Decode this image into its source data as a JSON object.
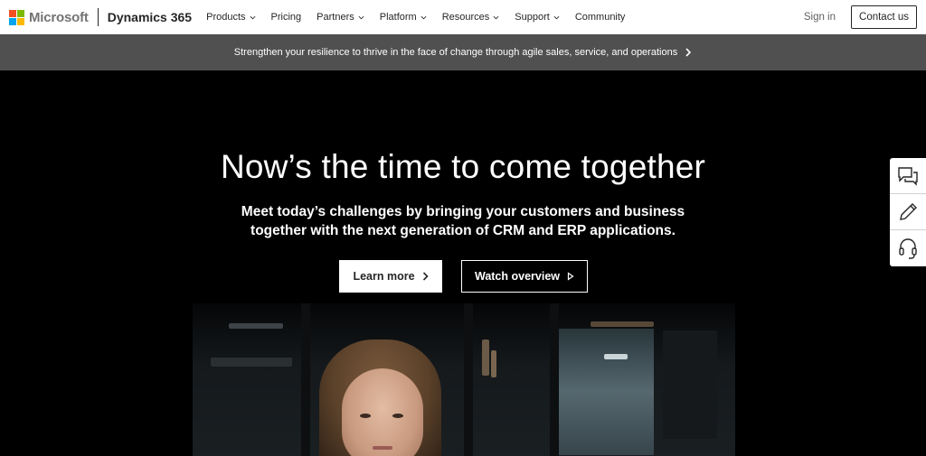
{
  "brand": {
    "company": "Microsoft",
    "product": "Dynamics 365",
    "logo_colors": [
      "#f25022",
      "#7fba00",
      "#00a4ef",
      "#ffb900"
    ]
  },
  "nav": {
    "items": [
      {
        "label": "Products",
        "has_dropdown": true
      },
      {
        "label": "Pricing",
        "has_dropdown": false
      },
      {
        "label": "Partners",
        "has_dropdown": true
      },
      {
        "label": "Platform",
        "has_dropdown": true
      },
      {
        "label": "Resources",
        "has_dropdown": true
      },
      {
        "label": "Support",
        "has_dropdown": true
      },
      {
        "label": "Community",
        "has_dropdown": false
      }
    ],
    "sign_in": "Sign in",
    "contact": "Contact us"
  },
  "banner": {
    "text": "Strengthen your resilience to thrive in the face of change through agile sales, service, and operations",
    "icon": "chevron-right-icon"
  },
  "hero": {
    "title": "Now’s the time to come together",
    "subtitle": "Meet today’s challenges by bringing your customers and business together with the next generation of CRM and ERP applications.",
    "primary_button": "Learn more",
    "secondary_button": "Watch overview"
  },
  "side_tools": [
    {
      "icon": "chat-icon"
    },
    {
      "icon": "pencil-icon"
    },
    {
      "icon": "headset-icon"
    }
  ],
  "colors": {
    "nav_bg": "#ffffff",
    "banner_bg": "#505050",
    "hero_bg": "#000000",
    "text_dark": "#262626"
  }
}
